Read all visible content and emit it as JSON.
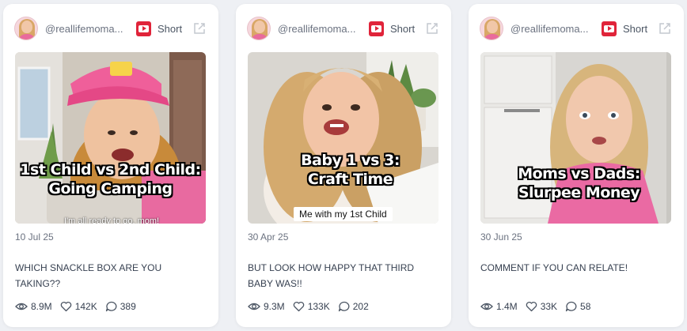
{
  "colors": {
    "page_bg": "#eef0f4",
    "card_bg": "#ffffff",
    "youtube_red": "#e0243a",
    "text_muted": "#6b7280",
    "text_body": "#374151"
  },
  "icons": {
    "platform": "youtube-icon",
    "external": "external-link-icon",
    "views": "eye-icon",
    "likes": "heart-icon",
    "comments": "comment-icon"
  },
  "cards": [
    {
      "handle": "@reallifemoma...",
      "type": "Short",
      "thumbnail_text": "1st Child vs 2nd Child: Going Camping",
      "thumbnail_lines": [
        "1st Child vs 2nd Child:",
        "Going Camping"
      ],
      "thumbnail_subtext": "I'm all ready to go, mom!",
      "date": "10 Jul 25",
      "description": "WHICH SNACKLE BOX ARE YOU TAKING??",
      "views": "8.9M",
      "likes": "142K",
      "comments": "389"
    },
    {
      "handle": "@reallifemoma...",
      "type": "Short",
      "thumbnail_lines": [
        "Baby 1 vs 3:",
        "Craft Time"
      ],
      "thumbnail_caption": "Me with my 1st Child",
      "date": "30 Apr 25",
      "description": "BUT LOOK HOW HAPPY THAT THIRD BABY WAS!!",
      "views": "9.3M",
      "likes": "133K",
      "comments": "202"
    },
    {
      "handle": "@reallifemoma...",
      "type": "Short",
      "thumbnail_lines": [
        "Moms vs Dads:",
        "Slurpee Money"
      ],
      "date": "30 Jun 25",
      "description": "COMMENT IF YOU CAN RELATE!",
      "views": "1.4M",
      "likes": "33K",
      "comments": "58"
    }
  ]
}
